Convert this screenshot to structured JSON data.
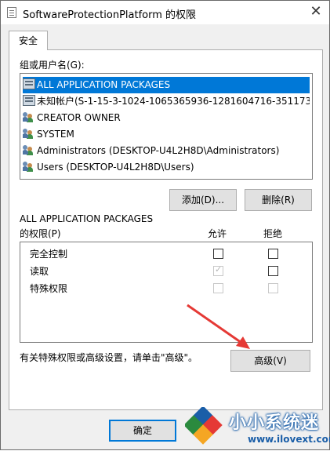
{
  "window": {
    "title": "SoftwareProtectionPlatform 的权限",
    "close_glyph": "✕"
  },
  "tab": {
    "label": "安全"
  },
  "group": {
    "label": "组或用户名(G):",
    "items": [
      {
        "label": "ALL APPLICATION PACKAGES",
        "icon": "package-icon",
        "selected": true
      },
      {
        "label": "未知帐户(S-1-15-3-1024-1065365936-1281604716-351173...",
        "icon": "package-icon",
        "selected": false
      },
      {
        "label": "CREATOR OWNER",
        "icon": "users-icon",
        "selected": false
      },
      {
        "label": "SYSTEM",
        "icon": "users-icon",
        "selected": false
      },
      {
        "label": "Administrators (DESKTOP-U4L2H8D\\Administrators)",
        "icon": "users-icon",
        "selected": false
      },
      {
        "label": "Users (DESKTOP-U4L2H8D\\Users)",
        "icon": "users-icon",
        "selected": false
      }
    ]
  },
  "buttons": {
    "add": "添加(D)...",
    "remove": "删除(R)",
    "advanced": "高级(V)",
    "ok": "确定"
  },
  "perms": {
    "title_line1": "ALL APPLICATION PACKAGES",
    "title_line2": "的权限(P)",
    "allow_header": "允许",
    "deny_header": "拒绝",
    "rows": [
      {
        "name": "完全控制",
        "allow": false,
        "deny": false,
        "disabled": false
      },
      {
        "name": "读取",
        "allow": true,
        "deny": false,
        "disabled_allow": true
      },
      {
        "name": "特殊权限",
        "allow": false,
        "deny": false,
        "disabled": true
      }
    ]
  },
  "advanced_hint": "有关特殊权限或高级设置，请单击\"高级\"。",
  "watermark": {
    "brand": "小小系统迷",
    "url": "www.ilovext.com"
  },
  "colors": {
    "selection": "#0078d7",
    "arrow": "#e53935",
    "watermark": "#1a5ea8"
  }
}
